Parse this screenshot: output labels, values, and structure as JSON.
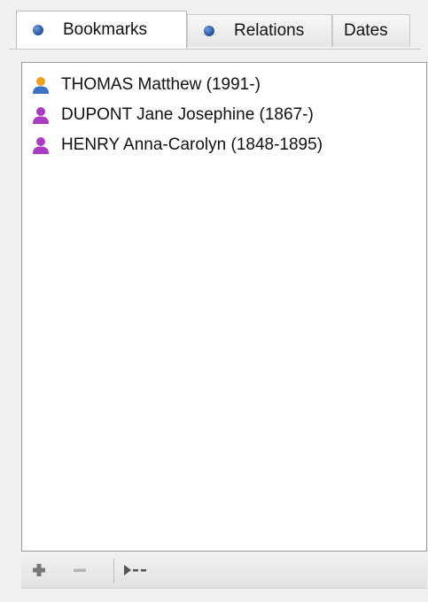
{
  "tabs": [
    {
      "label": "Bookmarks",
      "icon": "dot-icon",
      "active": true
    },
    {
      "label": "Relations",
      "icon": "dot-icon",
      "active": false
    },
    {
      "label": "Dates",
      "icon": null,
      "active": false
    }
  ],
  "bookmarks": [
    {
      "label": "THOMAS Matthew (1991-)",
      "icon": "person-male-icon",
      "color": "#f0a020"
    },
    {
      "label": "DUPONT Jane Josephine (1867-)",
      "icon": "person-female-icon",
      "color": "#a83dc0"
    },
    {
      "label": "HENRY Anna-Carolyn (1848-1895)",
      "icon": "person-female-icon",
      "color": "#a83dc0"
    }
  ],
  "toolbar": {
    "add_icon": "plus-icon",
    "remove_icon": "minus-icon",
    "go_icon": "arrow-dash-icon"
  },
  "colors": {
    "tab_dot": "#2e5ea8",
    "male_body": "#3b72c6",
    "male_head": "#f0a020",
    "female": "#a83dc0"
  }
}
